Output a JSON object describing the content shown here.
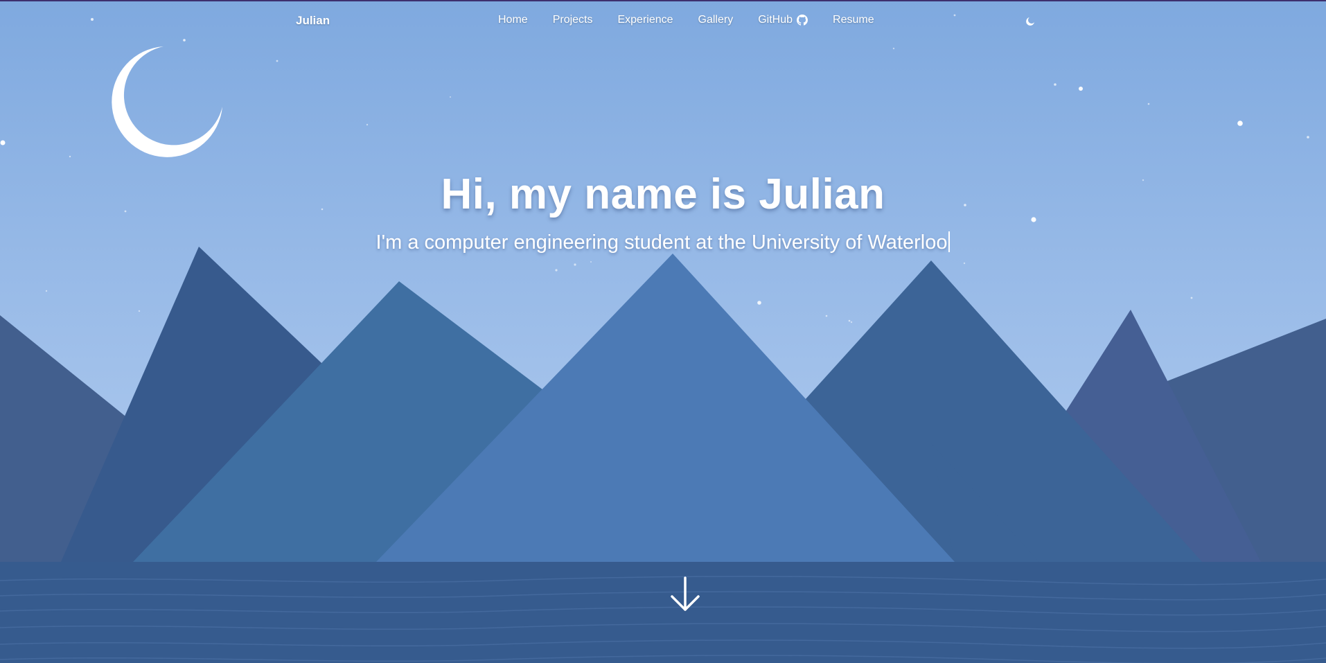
{
  "nav": {
    "brand": "Julian",
    "links": [
      {
        "label": "Home"
      },
      {
        "label": "Projects"
      },
      {
        "label": "Experience"
      },
      {
        "label": "Gallery"
      },
      {
        "label": "GitHub",
        "icon": "github-icon"
      },
      {
        "label": "Resume"
      }
    ],
    "theme_toggle_icon": "moon-icon"
  },
  "hero": {
    "title": "Hi, my name is Julian",
    "subtitle": "I'm a computer engineering student at the University of Waterloo"
  },
  "scroll_icon": "arrow-down-icon",
  "colors": {
    "sky_top": "#7fa9df",
    "sky_bottom": "#a6c4ec",
    "water": "#365b8e",
    "mountain_center": "#4c7ab5",
    "mountain_dark": "#365c90",
    "text": "#ffffff"
  }
}
